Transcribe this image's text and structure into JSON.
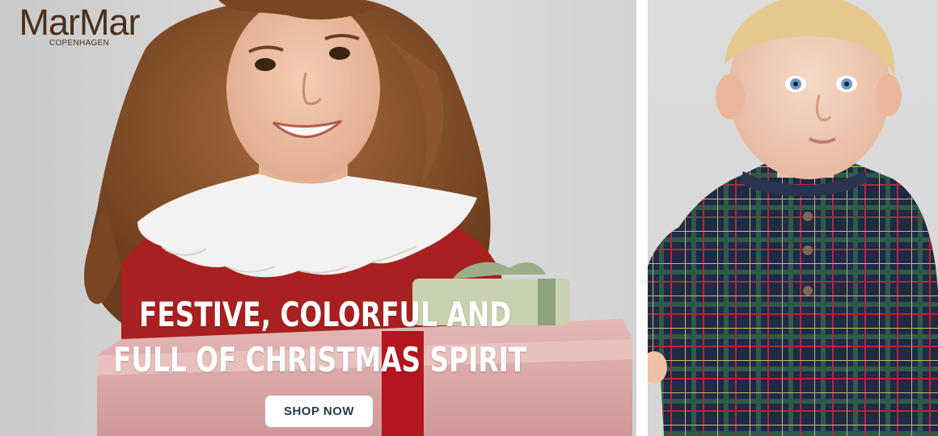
{
  "brand": {
    "name": "MarMar",
    "sub": "COPENHAGEN"
  },
  "hero": {
    "headline_line1": "FESTIVE, COLORFUL AND",
    "headline_line2": "FULL OF CHRISTMAS SPIRIT",
    "cta_label": "SHOP NOW"
  },
  "colors": {
    "logo": "#4a2f1a",
    "headline": "#ffffff",
    "button_bg": "#ffffff",
    "button_text": "#2a3a4a",
    "dress_red": "#a8201f",
    "collar_white": "#f4f2f0",
    "box_pink": "#d9a5a5",
    "ribbon_red": "#b3171d",
    "plaid_navy": "#1f2a44"
  },
  "images": {
    "left": "girl-with-gift-photo",
    "right": "baby-in-plaid-shirt-photo"
  }
}
